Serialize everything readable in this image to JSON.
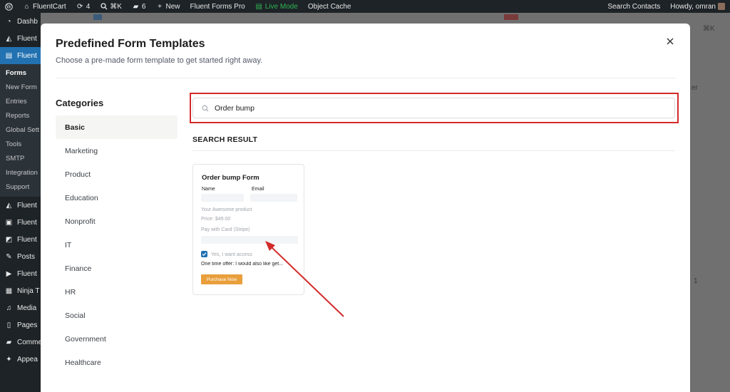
{
  "adminbar": {
    "site": "FluentCart",
    "updates": "4",
    "search_shortcut": "⌘K",
    "comments": "6",
    "new": "New",
    "plugin": "Fluent Forms Pro",
    "mode": "Live Mode",
    "cache": "Object Cache",
    "search_contacts": "Search Contacts",
    "howdy": "Howdy, omran"
  },
  "sidebar": {
    "items_top": [
      "Dashb",
      "Fluent",
      "Fluent"
    ],
    "subitems": [
      "Forms",
      "New Form",
      "Entries",
      "Reports",
      "Global Sett",
      "Tools",
      "SMTP",
      "Integration",
      "Support"
    ],
    "items_bottom": [
      "Fluent",
      "Fluent",
      "Fluent",
      "Posts",
      "Fluent",
      "Ninja T",
      "Media",
      "Pages",
      "Comme",
      "Appea"
    ]
  },
  "background": {
    "frag_shortcut": "⌘K",
    "frag_er": "er",
    "frag_one": "1"
  },
  "modal": {
    "title": "Predefined Form Templates",
    "subtitle": "Choose a pre-made form template to get started right away.",
    "categories_heading": "Categories",
    "categories": [
      "Basic",
      "Marketing",
      "Product",
      "Education",
      "Nonprofit",
      "IT",
      "Finance",
      "HR",
      "Social",
      "Government",
      "Healthcare"
    ],
    "active_category": "Basic",
    "search_value": "Order bump",
    "search_result_heading": "SEARCH RESULT"
  },
  "template_card": {
    "title": "Order bump Form",
    "name_label": "Name",
    "email_label": "Email",
    "product": "Your Awesome product",
    "price": "Price: $49.00",
    "payment": "Pay with Card (Stripe)",
    "checkbox_label": "Yes, I want access",
    "offer": "One time offer: I would also like get...",
    "button": "Purchase Now"
  },
  "colors": {
    "admin_bg": "#1d2327",
    "live_green": "#2eb553",
    "highlight_red": "#d22b2b",
    "button_orange": "#e89f3c",
    "checkbox_blue": "#2271b1"
  }
}
